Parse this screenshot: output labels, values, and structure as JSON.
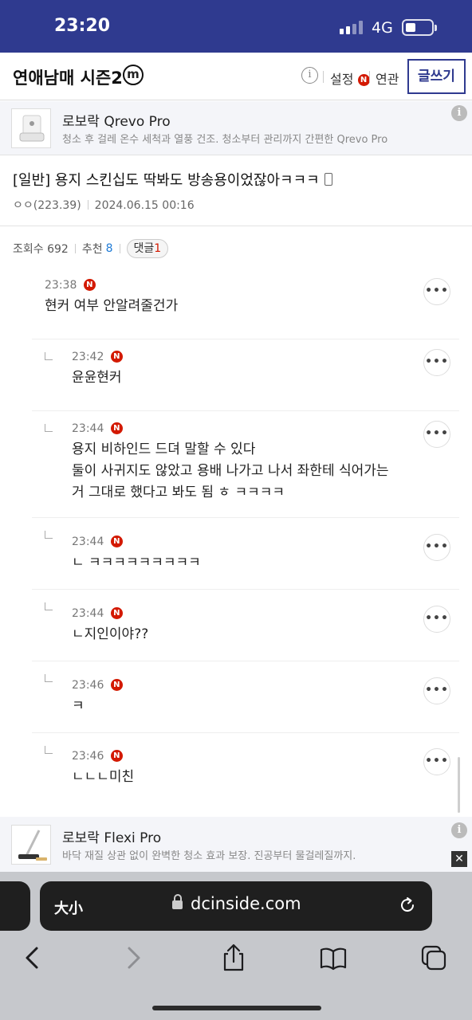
{
  "status": {
    "time": "23:20",
    "network": "4G"
  },
  "header": {
    "gallery_title": "연애남매 시즌2",
    "minor_badge": "m",
    "info_symbol": "i",
    "settings_label": "설정",
    "settings_badge": "N",
    "related_label": "연관",
    "write_label": "글쓰기"
  },
  "ad_top": {
    "name": "로보락 Qrevo Pro",
    "desc": "청소 후 걸레 온수 세척과 열풍 건조. 청소부터 관리까지 간편한 Qrevo Pro",
    "info_symbol": "i"
  },
  "post": {
    "title": "[일반] 용지 스킨십도 딱봐도 방송용이었잖아ㅋㅋㅋ",
    "author": "ㅇㅇ(223.39)",
    "datetime": "2024.06.15 00:16",
    "views_label": "조회수 692",
    "recommend_label": "추천",
    "recommend_count": "8",
    "comment_label": "댓글",
    "comment_count": "1"
  },
  "comments": [
    {
      "time": "23:38",
      "badge": "N",
      "text": "현커 여부 안알려줄건가",
      "more": "•••"
    },
    {
      "time": "23:42",
      "badge": "N",
      "text": "윤윤현커",
      "more": "•••"
    },
    {
      "time": "23:44",
      "badge": "N",
      "line1": "용지 비하인드 드뎌 말할 수 있다",
      "line2": "둘이 사귀지도 않았고 용배 나가고 나서 좌한테 식어가는",
      "line3": "거 그대로 했다고 봐도 됨 ㅎ ㅋㅋㅋㅋ",
      "more": "•••"
    },
    {
      "time": "23:44",
      "badge": "N",
      "text": "ㄴ ㅋㅋㅋㅋㅋㅋㅋㅋㅋ",
      "more": "•••"
    },
    {
      "time": "23:44",
      "badge": "N",
      "text": "ㄴ지인이야??",
      "more": "•••"
    },
    {
      "time": "23:46",
      "badge": "N",
      "text": "ㅋ",
      "more": "•••"
    },
    {
      "time": "23:46",
      "badge": "N",
      "text": "ㄴㄴㄴ미친",
      "more": "•••"
    }
  ],
  "ad_bottom": {
    "name": "로보락 Flexi Pro",
    "desc": "바닥 재질 상관 없이 완벽한 청소 효과 보장. 진공부터 물걸레질까지.",
    "info_symbol": "i",
    "close_symbol": "✕"
  },
  "browser": {
    "aa_label": "大小",
    "url": "dcinside.com"
  },
  "colors": {
    "brand": "#2f3a8f",
    "new_badge": "#d31900",
    "link_blue": "#1f7bd6"
  }
}
